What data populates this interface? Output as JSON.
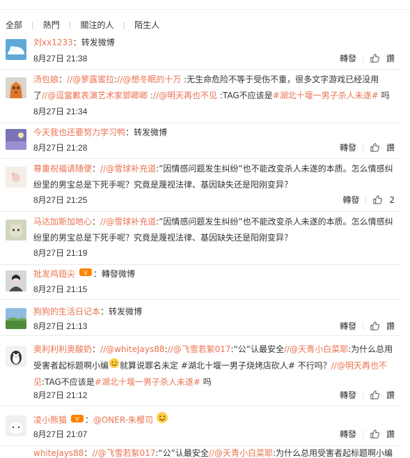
{
  "tabs": [
    "全部",
    "熱門",
    "關注的人",
    "陌生人"
  ],
  "actions": {
    "repost": "轉發",
    "reply": "讚"
  },
  "comments": [
    {
      "user": "刘xx1233",
      "sep": "：",
      "text": "转发微博",
      "time": "8月27日 21:38",
      "likes": ""
    },
    {
      "user": "汤包娘",
      "sep": "：",
      "at1": "//@萝露蜜拉",
      "mid1": ":",
      "at2": "//@想冬眠的十万",
      "line1_rest": " :无生命危险不等于受伤不重，很多文字游戏已经没用",
      "line2_a": "了",
      "at3": "//@逗當歉表演艺术家鄧卿卿",
      "mid2": " :",
      "at4": "//@明天再也不见",
      "line2_b": " :TAG不应该是",
      "tag": "#湖北十堰一男子杀人未遂#",
      "line2_c": " 吗",
      "time": "8月27日 21:34",
      "likes": ""
    },
    {
      "user": "今天我也还要努力学习鸭",
      "sep": "：",
      "text": "转发微博",
      "time": "8月27日 21:28",
      "likes": ""
    },
    {
      "user": "尊重祝福请随便",
      "sep": "：",
      "at1": "//@雪球补充道",
      "line1_rest": ":”因情感问题发生纠纷”也不能改变杀人未遂的本质。怎么情感纠",
      "line2": "纷里的男宝总是下死手呢？究竟是蔑视法律、基因缺失还是阳刚变异？",
      "time": "8月27日 21:25",
      "likes": "2"
    },
    {
      "user": "马达加斯加地心",
      "sep": "：",
      "at1": "//@雪球补充道",
      "line1_rest": ":”因情感问题发生纠纷”也不能改变杀人未遂的本质。怎么情感纠",
      "line2": "纷里的男宝总是下死手呢？究竟是蔑视法律、基因缺失还是阳刚变异？",
      "time": "8月27日 21:19",
      "likes": ""
    },
    {
      "user": "批发鸡翅尖",
      "sep": "：",
      "text": "轉發微博",
      "time": "8月27日 21:15",
      "likes": ""
    },
    {
      "user": "狗狗的生活日记本",
      "sep": "：",
      "text": "转发微博",
      "time": "8月27日 21:13",
      "likes": ""
    },
    {
      "user": "奥利利利奥酸奶",
      "sep": "：",
      "at1": "//@whiteJays88",
      "mid1": ":",
      "at2": "//@飞雪若絮017",
      "line1_a": ":“公”认最安全",
      "at3": "//@天青小白菜耶",
      "line1_b": ":为什么总用",
      "line2_a": "受害者起标题啊小编",
      "line2_b": "就算说罪名未定 #湖北十堰一男子烧烤店砍人# 不行吗？",
      "at4": "//@明天再也不",
      "line3_a": "见",
      "line3_b": ":TAG不应该是",
      "tag": "#湖北十堰一男子杀人未遂#",
      "line3_c": " 吗",
      "time": "8月27日 21:12",
      "likes": ""
    },
    {
      "user": "凌小熊猫",
      "sep": "：",
      "at1": "@ONER-朱樱司",
      "time": "8月27日 21:07",
      "likes": ""
    },
    {
      "user": "whiteJays88",
      "sep": "：",
      "at1": "//@飞雪若絮017",
      "line1_a": ":“公”认最安全",
      "at2": "//@天青小白菜耶",
      "line1_b": ":为什么总用受害者起标题啊小编"
    }
  ]
}
